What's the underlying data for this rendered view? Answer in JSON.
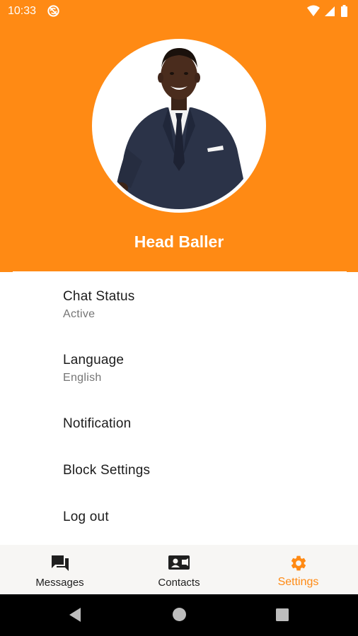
{
  "status_bar": {
    "time": "10:33",
    "icons": [
      "sync-disabled-icon",
      "wifi-icon",
      "cell-signal-icon",
      "battery-icon"
    ]
  },
  "colors": {
    "accent": "#FF8A14",
    "text_primary": "#1c1c1c",
    "text_secondary": "#757575",
    "nav_background": "#F7F6F4"
  },
  "profile": {
    "name": "Head Baller"
  },
  "settings": {
    "items": [
      {
        "title": "Chat Status",
        "subtitle": "Active"
      },
      {
        "title": "Language",
        "subtitle": "English"
      },
      {
        "title": "Notification",
        "subtitle": ""
      },
      {
        "title": "Block Settings",
        "subtitle": ""
      },
      {
        "title": "Log out",
        "subtitle": ""
      }
    ]
  },
  "bottom_nav": {
    "items": [
      {
        "label": "Messages",
        "icon": "forum-icon",
        "active": false
      },
      {
        "label": "Contacts",
        "icon": "contact-card-icon",
        "active": false
      },
      {
        "label": "Settings",
        "icon": "gear-icon",
        "active": true
      }
    ]
  },
  "system_nav": {
    "buttons": [
      "back-icon",
      "home-icon",
      "recents-icon"
    ]
  }
}
